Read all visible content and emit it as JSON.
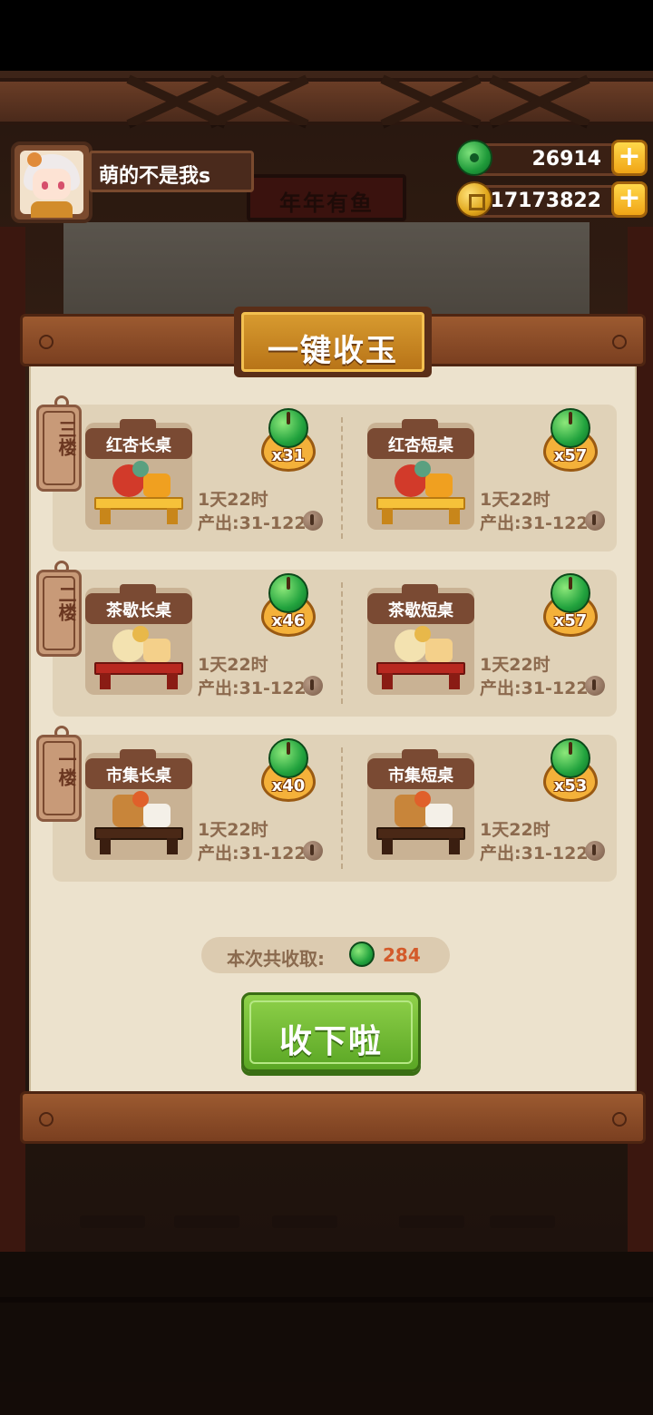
{
  "hud": {
    "username": "萌的不是我s",
    "jade_amount": "26914",
    "coin_amount": "17173822",
    "plus": "+"
  },
  "background": {
    "sign_text": "年年有鱼"
  },
  "dialog": {
    "title": "一键收玉",
    "floors": [
      {
        "tag": "三楼",
        "items": [
          {
            "name": "红杏长桌",
            "count": "x31",
            "time": "1天22时",
            "output": "产出:31-122",
            "theme": "apricot"
          },
          {
            "name": "红杏短桌",
            "count": "x57",
            "time": "1天22时",
            "output": "产出:31-122",
            "theme": "apricot"
          }
        ]
      },
      {
        "tag": "二楼",
        "items": [
          {
            "name": "茶歇长桌",
            "count": "x46",
            "time": "1天22时",
            "output": "产出:31-122",
            "theme": "tea"
          },
          {
            "name": "茶歇短桌",
            "count": "x57",
            "time": "1天22时",
            "output": "产出:31-122",
            "theme": "tea"
          }
        ]
      },
      {
        "tag": "一楼",
        "items": [
          {
            "name": "市集长桌",
            "count": "x40",
            "time": "1天22时",
            "output": "产出:31-122",
            "theme": "market"
          },
          {
            "name": "市集短桌",
            "count": "x53",
            "time": "1天22时",
            "output": "产出:31-122",
            "theme": "market"
          }
        ]
      }
    ],
    "total_label": "本次共收取:",
    "total_value": "284",
    "collect_button": "收下啦"
  },
  "colors": {
    "jade": "#22a33e",
    "coin": "#e0a61b",
    "button_green": "#6db52e",
    "total_red": "#d35a2a",
    "paper": "#ece2cd"
  },
  "icons": {
    "jade": "jade-icon",
    "coin": "coin-icon",
    "copper": "copper-coin-icon"
  }
}
